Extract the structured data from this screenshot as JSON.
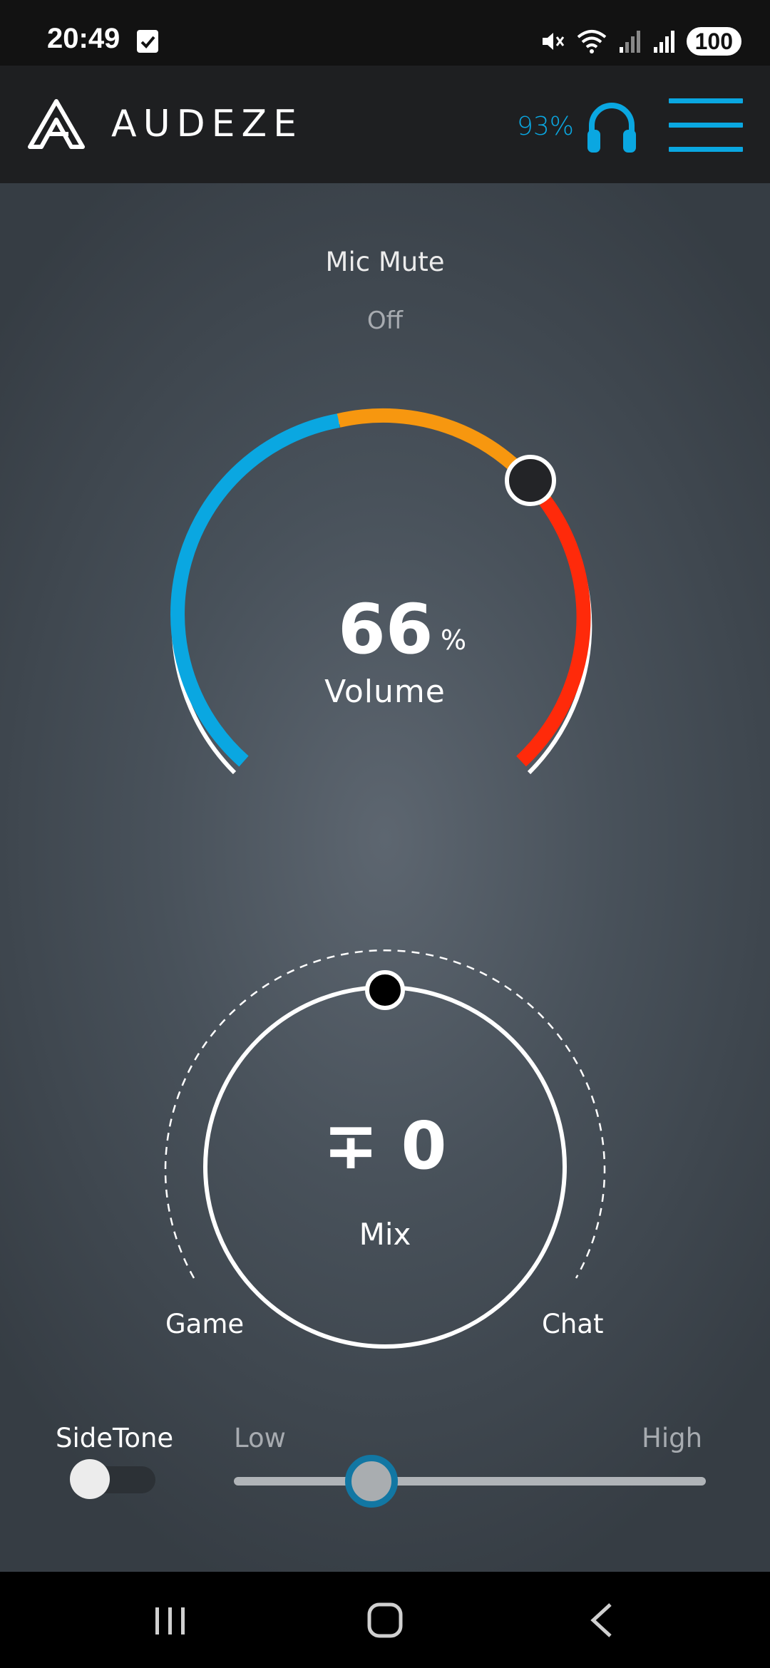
{
  "status_bar": {
    "time": "20:49",
    "battery": "100"
  },
  "header": {
    "brand": "AUDEZE",
    "headset_battery": "93%"
  },
  "mic_mute": {
    "label": "Mic Mute",
    "state": "Off"
  },
  "volume": {
    "value": "66",
    "unit": "%",
    "label": "Volume",
    "level": 0.66,
    "colors": {
      "low": "#0aa7e1",
      "mid": "#f7970f",
      "high": "#ff2a0a"
    }
  },
  "mix": {
    "value": "∓ 0",
    "label": "Mix",
    "left_label": "Game",
    "right_label": "Chat",
    "balance": 0
  },
  "sidetone": {
    "label": "SideTone",
    "enabled": false,
    "low_label": "Low",
    "high_label": "High",
    "level": 0.29
  },
  "icons": {
    "logo": "audeze-logo-icon",
    "headphones": "headphones-icon",
    "menu": "menu-icon",
    "mute": "mute-icon",
    "wifi": "wifi-icon",
    "signal": "signal-icon",
    "nav_recents": "recents-icon",
    "nav_home": "home-icon",
    "nav_back": "back-icon"
  },
  "accent_color": "#0aa7e1"
}
